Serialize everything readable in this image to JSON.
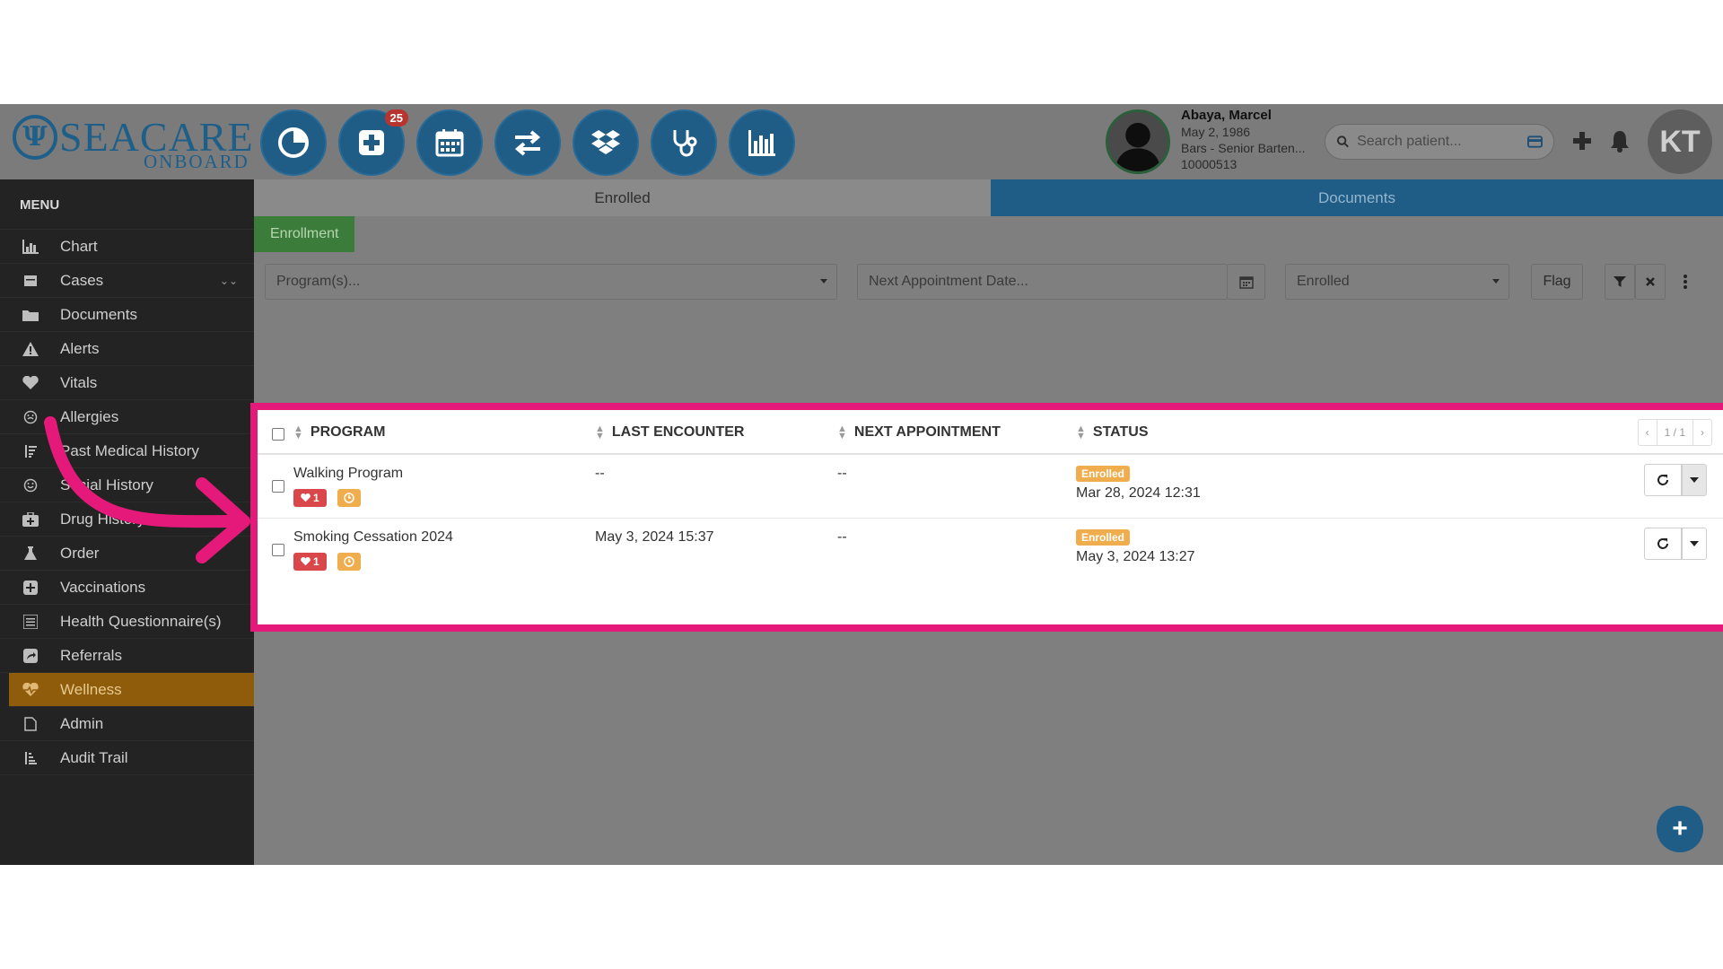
{
  "logo": {
    "name": "SEACARE",
    "sub": "ONBOARD"
  },
  "toolbar": {
    "notification_count": "25",
    "buttons": [
      "dashboard-icon",
      "add-record-icon",
      "calendar-icon",
      "transfer-icon",
      "dropbox-icon",
      "stethoscope-icon",
      "bar-chart-icon"
    ]
  },
  "patient": {
    "name": "Abaya, Marcel",
    "dob": "May 2, 1986",
    "position": "Bars - Senior Barten...",
    "id": "10000513"
  },
  "search": {
    "placeholder": "Search patient..."
  },
  "user": {
    "initials": "KT"
  },
  "sidebar": {
    "header": "MENU",
    "items": [
      {
        "label": "Chart",
        "icon": "bar-chart-icon"
      },
      {
        "label": "Cases",
        "icon": "cases-icon"
      },
      {
        "label": "Documents",
        "icon": "folder-icon"
      },
      {
        "label": "Alerts",
        "icon": "warning-icon"
      },
      {
        "label": "Vitals",
        "icon": "heart-icon"
      },
      {
        "label": "Allergies",
        "icon": "allergy-icon"
      },
      {
        "label": "Past Medical History",
        "icon": "history-icon"
      },
      {
        "label": "Social History",
        "icon": "smile-icon"
      },
      {
        "label": "Drug History",
        "icon": "medkit-icon"
      },
      {
        "label": "Order",
        "icon": "flask-icon"
      },
      {
        "label": "Vaccinations",
        "icon": "plus-square-icon"
      },
      {
        "label": "Health Questionnaire(s)",
        "icon": "list-icon"
      },
      {
        "label": "Referrals",
        "icon": "share-icon"
      },
      {
        "label": "Wellness",
        "icon": "heartbeat-icon"
      },
      {
        "label": "Admin",
        "icon": "file-icon"
      },
      {
        "label": "Audit Trail",
        "icon": "audit-icon"
      }
    ]
  },
  "tabs": {
    "enrolled": "Enrolled",
    "documents": "Documents"
  },
  "subtab": "Enrollment",
  "filters": {
    "program_placeholder": "Program(s)...",
    "appointment_placeholder": "Next Appointment Date...",
    "status_value": "Enrolled",
    "flag_label": "Flag"
  },
  "table": {
    "headers": {
      "program": "PROGRAM",
      "last_encounter": "LAST ENCOUNTER",
      "next_appointment": "NEXT APPOINTMENT",
      "status": "STATUS"
    },
    "pager": {
      "prev": "‹",
      "page": "1 / 1",
      "next": "›"
    },
    "rows": [
      {
        "program": "Walking Program",
        "heart_count": "1",
        "last_encounter": "--",
        "next_appointment": "--",
        "status": "Enrolled",
        "status_date": "Mar 28, 2024 12:31"
      },
      {
        "program": "Smoking Cessation 2024",
        "heart_count": "1",
        "last_encounter": "May 3, 2024 15:37",
        "next_appointment": "--",
        "status": "Enrolled",
        "status_date": "May 3, 2024 13:27"
      }
    ]
  },
  "fab": "+",
  "colors": {
    "brand": "#1f5c86",
    "active": "#8f5c0c",
    "highlight": "#e5197a",
    "status": "#f0ad4e"
  }
}
